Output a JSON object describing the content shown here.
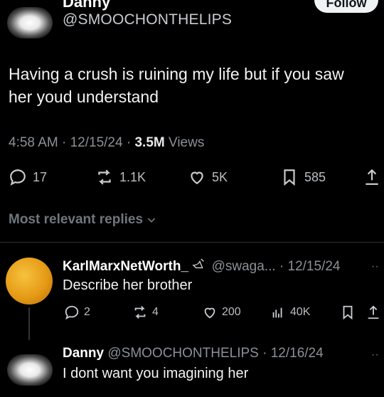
{
  "tweet": {
    "author_name_cut": "Danny",
    "handle": "@SMOOCHONTHELIPS",
    "follow_label": "Follow",
    "text": "Having a crush is ruining my life but if you saw her youd understand",
    "time": "4:58 AM",
    "date": "12/15/24",
    "views_count": "3.5M",
    "views_label": "Views",
    "replies": "17",
    "reposts": "1.1K",
    "likes": "5K",
    "bookmarks": "585"
  },
  "replies_header": "Most relevant replies",
  "reply1": {
    "name": "KarlMarxNetWorth_",
    "handle_date": "@swaga... · 12/15/24",
    "text": "Describe her brother",
    "replies": "2",
    "reposts": "4",
    "likes": "200",
    "views": "40K",
    "more": "··"
  },
  "reply2": {
    "name": "Danny",
    "handle_date": "@SMOOCHONTHELIPS · 12/16/24",
    "text": "I dont want you imagining her",
    "more": "··"
  }
}
